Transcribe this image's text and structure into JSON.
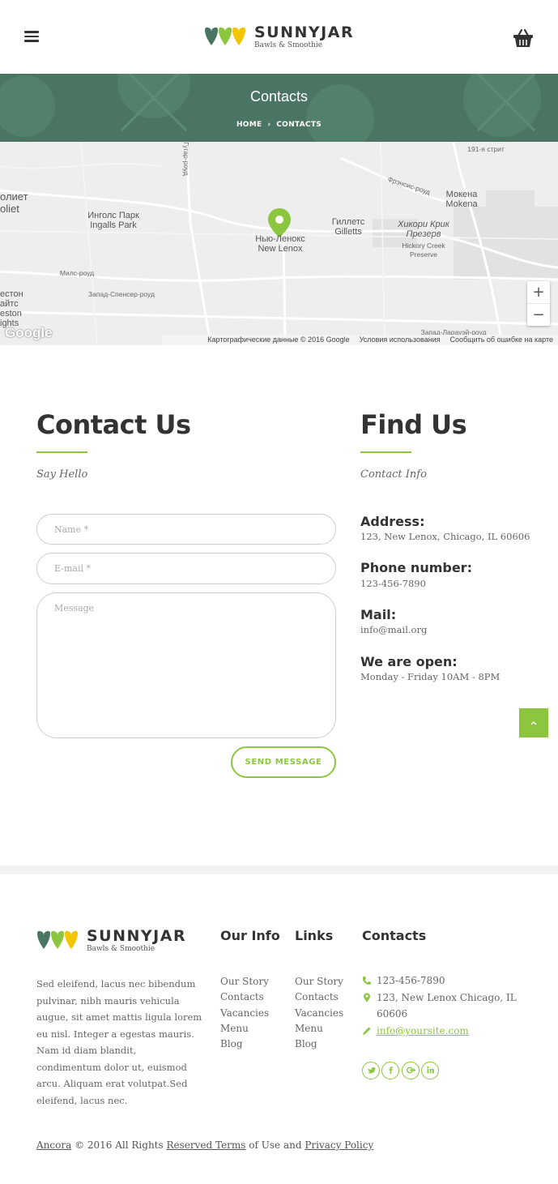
{
  "header": {
    "brand_name": "SUNNYJAR",
    "brand_tagline": "Bawls & Smoothie",
    "icons": [
      "menu-icon",
      "cart-icon"
    ]
  },
  "hero": {
    "title": "Contacts",
    "breadcrumb_home": "HOME",
    "breadcrumb_separator": "›",
    "breadcrumb_current": "CONTACTS"
  },
  "map": {
    "labels": {
      "joliet_ru": "олиет",
      "joliet_en": "oliet",
      "ingalls_ru": "Инголс Парк",
      "ingalls_en": "Ingalls Park",
      "newlenox_ru": "Нью-Ленокс",
      "newlenox_en": "New Lenox",
      "gillets_ru": "Гиллетс",
      "gillets_en": "Gilletts",
      "mokena_ru": "Мокена",
      "mokena_en": "Mokena",
      "hickory_ru1": "Хикори Крик",
      "hickory_ru2": "Презерв",
      "hickory_en1": "Hickory Creek",
      "hickory_en2": "Preserve",
      "road_191": "191-я стрит",
      "road_francis": "Фрэнсис-роуд",
      "road_miles": "Милс-роуд",
      "road_spencer": "Запад-Спенсер-роуд",
      "road_laraway": "Запад-Ларауэй-роуд",
      "road_gougar": "Гугар-роуд",
      "left_1": "естон",
      "left_2": "айтс",
      "left_3": "eston",
      "left_4": "ights"
    },
    "zoom_in": "+",
    "zoom_out": "−",
    "google_logo": "Google",
    "attribution": {
      "data": "Картографические данные © 2016 Google",
      "terms": "Условия использования",
      "report": "Сообщить об ошибке на карте"
    }
  },
  "contact_form": {
    "title": "Contact Us",
    "subtitle": "Say Hello",
    "name_placeholder": "Name *",
    "email_placeholder": "E-mail *",
    "message_placeholder": "Message",
    "submit_label": "SEND MESSAGE"
  },
  "find_us": {
    "title": "Find Us",
    "subtitle": "Contact Info",
    "items": [
      {
        "label": "Address:",
        "value": "123, New Lenox, Chicago, IL 60606"
      },
      {
        "label": "Phone number:",
        "value": "123-456-7890"
      },
      {
        "label": "Mail:",
        "value": "info@mail.org"
      },
      {
        "label": "We are open:",
        "value": "Monday - Friday 10AM - 8PM"
      }
    ]
  },
  "footer": {
    "brand_name": "SUNNYJAR",
    "brand_tagline": "Bawls & Smoothie",
    "about": "Sed eleifend, lacus nec bibendum pulvinar, nibh mauris vehicula augue, sit amet mattis ligula lorem eu nisl. Integer a egestas mauris. Nam id diam blandit, condimentum dolor ut, euismod arcu. Aliquam erat volutpat.Sed eleifend, lacus nec.",
    "our_info": {
      "title": "Our Info",
      "links": [
        "Our Story",
        "Contacts",
        "Vacancies",
        "Menu",
        "Blog"
      ]
    },
    "links": {
      "title": "Links",
      "links": [
        "Our Story",
        "Contacts",
        "Vacancies",
        "Menu",
        "Blog"
      ]
    },
    "contacts": {
      "title": "Contacts",
      "phone": "123-456-7890",
      "address": "123, New Lenox Chicago, IL 60606",
      "email": "info@yoursite.com"
    },
    "social": [
      "twitter-icon",
      "facebook-icon",
      "google-plus-icon",
      "linkedin-icon"
    ],
    "copyright": {
      "brand": "Ancora",
      "year_text": "© 2016 All Rights",
      "reserved_terms": "Reserved Terms",
      "of_use_and": "of Use and",
      "privacy": "Privacy Policy"
    }
  },
  "colors": {
    "accent": "#8cc63f",
    "hero_bg": "#4a7562",
    "text_dark": "#333333"
  }
}
